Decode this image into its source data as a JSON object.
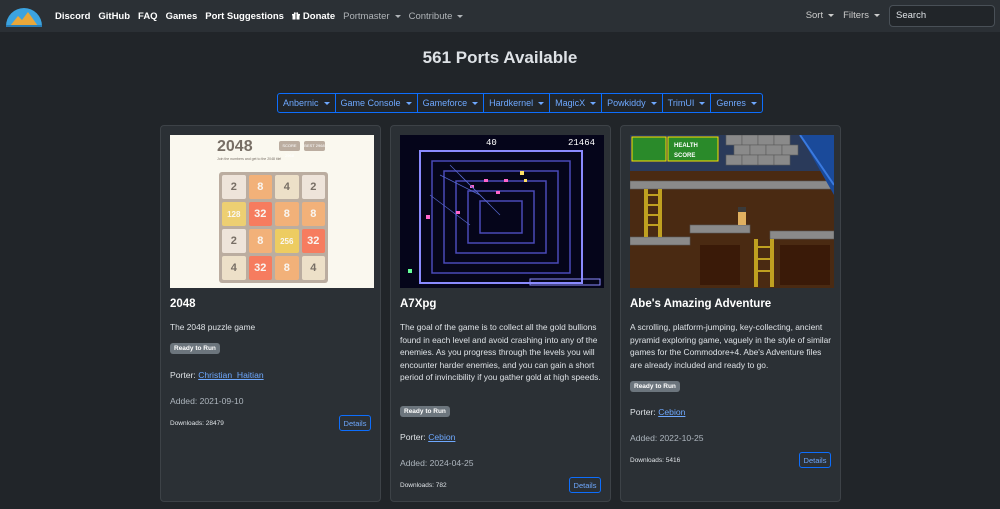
{
  "navbar": {
    "links": [
      "Discord",
      "GitHub",
      "FAQ",
      "Games",
      "Port Suggestions",
      "Donate"
    ],
    "dropdowns": [
      "Portmaster",
      "Contribute"
    ],
    "sort_label": "Sort",
    "filters_label": "Filters",
    "search_placeholder": "Search"
  },
  "header": {
    "title": "561 Ports Available"
  },
  "filters": [
    "Anbernic",
    "Game Console",
    "Gameforce",
    "Hardkernel",
    "MagicX",
    "Powkiddy",
    "TrimUI",
    "Genres"
  ],
  "colors": {
    "accent": "#0d6efd",
    "link": "#6ea8fe",
    "badge": "#6c757d",
    "card_bg": "#2b3035",
    "page_bg": "#212529"
  },
  "cards": [
    {
      "title": "2048",
      "description": "The 2048 puzzle game",
      "badge": "Ready to Run",
      "porter_label": "Porter: ",
      "porter": "Christian_Haitian",
      "added": "Added: 2021-09-10",
      "downloads": "Downloads: 28479",
      "details_label": "Details",
      "screenshot": {
        "title": "2048",
        "score_label": "SCORE",
        "score": "2968",
        "best_label": "BEST",
        "best": "2968",
        "subtitle": "Join the numbers and get to the 2048 tile!",
        "tiles": [
          "2",
          "8",
          "4",
          "2",
          "128",
          "32",
          "8",
          "8",
          "2",
          "8",
          "256",
          "32",
          "4",
          "32",
          "8",
          "4"
        ]
      }
    },
    {
      "title": "A7Xpg",
      "description": "The goal of the game is to collect all the gold bullions found in each level and avoid crashing into any of the enemies. As you progress through the levels you will encounter harder enemies, and you can gain a short period of invincibility if you gather gold at high speeds.",
      "badge": "Ready to Run",
      "porter_label": "Porter: ",
      "porter": "Cebion",
      "added": "Added: 2024-04-25",
      "downloads": "Downloads: 782",
      "details_label": "Details",
      "screenshot": {
        "score_left": "40",
        "score_right": "21464"
      }
    },
    {
      "title": "Abe's Amazing Adventure",
      "description": "A scrolling, platform-jumping, key-collecting, ancient pyramid exploring game, vaguely in the style of similar games for the Commodore+4. Abe's Adventure files are already included and ready to go.",
      "badge": "Ready to Run",
      "porter_label": "Porter: ",
      "porter": "Cebion",
      "added": "Added: 2022-10-25",
      "downloads": "Downloads: 5416",
      "details_label": "Details",
      "screenshot": {
        "health_label": "HEALTH",
        "score_label": "SCORE"
      }
    }
  ]
}
